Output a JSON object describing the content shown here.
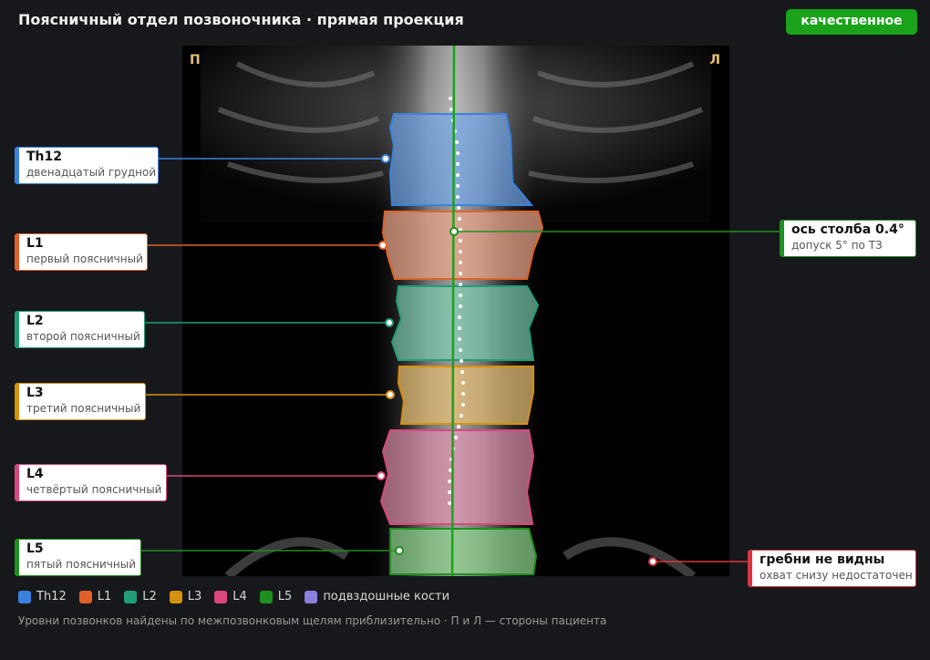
{
  "header": {
    "title": "Поясничный отдел позвоночника · прямая проекция",
    "quality_badge": "качественное",
    "badge_color": "#1aa31a"
  },
  "image": {
    "left_side_mark": "П",
    "right_side_mark": "Л"
  },
  "vertebrae": [
    {
      "id": "Th12",
      "name": "Th12",
      "desc": "двенадцатый грудной",
      "color": "#3b82e0"
    },
    {
      "id": "L1",
      "name": "L1",
      "desc": "первый поясничный",
      "color": "#e0612a"
    },
    {
      "id": "L2",
      "name": "L2",
      "desc": "второй поясничный",
      "color": "#1f9e78"
    },
    {
      "id": "L3",
      "name": "L3",
      "desc": "третий поясничный",
      "color": "#d4900f"
    },
    {
      "id": "L4",
      "name": "L4",
      "desc": "четвёртый поясничный",
      "color": "#d9477c"
    },
    {
      "id": "L5",
      "name": "L5",
      "desc": "пятый поясничный",
      "color": "#1f8f1f"
    }
  ],
  "axis_callout": {
    "name": "ось столба 0.4°",
    "desc": "допуск 5° по ТЗ",
    "color": "#1f8f1f"
  },
  "warning_callout": {
    "name": "гребни не видны",
    "desc": "охват снизу недостаточен",
    "color": "#d9363e"
  },
  "legend": [
    {
      "label": "Th12",
      "color": "#3b82e0"
    },
    {
      "label": "L1",
      "color": "#e0612a"
    },
    {
      "label": "L2",
      "color": "#1f9e78"
    },
    {
      "label": "L3",
      "color": "#d4900f"
    },
    {
      "label": "L4",
      "color": "#d9477c"
    },
    {
      "label": "L5",
      "color": "#1f8f1f"
    },
    {
      "label": "подвздошные кости",
      "color": "#8b7fe0"
    }
  ],
  "footnote": "Уровни позвонков найдены по межпозвонковым щелям приблизительно · П и Л — стороны пациента"
}
